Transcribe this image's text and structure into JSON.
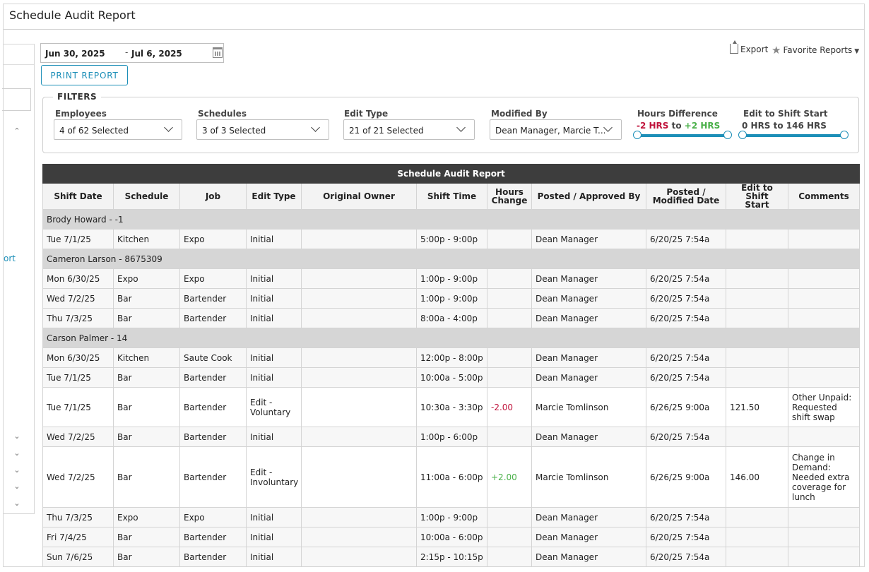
{
  "window": {
    "title": "Schedule Audit Report"
  },
  "left_panel": {
    "link_fragment": "ort"
  },
  "date_range": {
    "start": "Jun 30, 2025",
    "separator": "-",
    "end": "Jul 6, 2025"
  },
  "toolbar": {
    "print_label": "PRINT REPORT",
    "export_label": "Export",
    "favorites_label": "Favorite Reports"
  },
  "filters": {
    "legend": "FILTERS",
    "employees": {
      "label": "Employees",
      "value": "4 of 62 Selected"
    },
    "schedules": {
      "label": "Schedules",
      "value": "3 of 3 Selected"
    },
    "edit_type": {
      "label": "Edit Type",
      "value": "21 of 21 Selected"
    },
    "modified_by": {
      "label": "Modified By",
      "value": "Dean Manager, Marcie T..."
    },
    "hours_difference": {
      "label": "Hours Difference",
      "min": "-2 HRS",
      "to": "to",
      "max": "+2 HRS"
    },
    "edit_to_shift_start": {
      "label": "Edit to Shift Start",
      "range": "0 HRS to 146 HRS"
    }
  },
  "report": {
    "title": "Schedule Audit Report",
    "columns": {
      "shift_date": "Shift Date",
      "schedule": "Schedule",
      "job": "Job",
      "edit_type": "Edit Type",
      "original_owner": "Original Owner",
      "shift_time": "Shift Time",
      "hours_change_1": "Hours",
      "hours_change_2": "Change",
      "posted_by": "Posted / Approved By",
      "posted_date_1": "Posted /",
      "posted_date_2": "Modified Date",
      "edit_start_1": "Edit to Shift",
      "edit_start_2": "Start",
      "comments": "Comments"
    },
    "groups": [
      {
        "name": "Brody Howard - -1"
      },
      {
        "name": "Cameron Larson - 8675309"
      },
      {
        "name": "Carson Palmer - 14"
      }
    ],
    "rows": [
      {
        "date": "Tue 7/1/25",
        "schedule": "Kitchen",
        "job": "Expo",
        "edit_type": "Initial",
        "original_owner": "",
        "shift_time": "5:00p - 9:00p",
        "hours_change": "",
        "posted_by": "Dean Manager",
        "posted_date": "6/20/25 7:54a",
        "edit_to_start": "",
        "comments": ""
      },
      {
        "date": "Mon 6/30/25",
        "schedule": "Expo",
        "job": "Expo",
        "edit_type": "Initial",
        "original_owner": "",
        "shift_time": "1:00p - 9:00p",
        "hours_change": "",
        "posted_by": "Dean Manager",
        "posted_date": "6/20/25 7:54a",
        "edit_to_start": "",
        "comments": ""
      },
      {
        "date": "Wed 7/2/25",
        "schedule": "Bar",
        "job": "Bartender",
        "edit_type": "Initial",
        "original_owner": "",
        "shift_time": "1:00p - 9:00p",
        "hours_change": "",
        "posted_by": "Dean Manager",
        "posted_date": "6/20/25 7:54a",
        "edit_to_start": "",
        "comments": ""
      },
      {
        "date": "Thu 7/3/25",
        "schedule": "Bar",
        "job": "Bartender",
        "edit_type": "Initial",
        "original_owner": "",
        "shift_time": "8:00a - 4:00p",
        "hours_change": "",
        "posted_by": "Dean Manager",
        "posted_date": "6/20/25 7:54a",
        "edit_to_start": "",
        "comments": ""
      },
      {
        "date": "Mon 6/30/25",
        "schedule": "Kitchen",
        "job": "Saute Cook",
        "edit_type": "Initial",
        "original_owner": "",
        "shift_time": "12:00p - 8:00p",
        "hours_change": "",
        "posted_by": "Dean Manager",
        "posted_date": "6/20/25 7:54a",
        "edit_to_start": "",
        "comments": ""
      },
      {
        "date": "Tue 7/1/25",
        "schedule": "Bar",
        "job": "Bartender",
        "edit_type": "Initial",
        "original_owner": "",
        "shift_time": "10:00a - 5:00p",
        "hours_change": "",
        "posted_by": "Dean Manager",
        "posted_date": "6/20/25 7:54a",
        "edit_to_start": "",
        "comments": ""
      },
      {
        "date": "Tue 7/1/25",
        "schedule": "Bar",
        "job": "Bartender",
        "edit_type": "Edit - Voluntary",
        "original_owner": "",
        "shift_time": "10:30a - 3:30p",
        "hours_change": "-2.00",
        "posted_by": "Marcie Tomlinson",
        "posted_date": "6/26/25 9:00a",
        "edit_to_start": "121.50",
        "comments": "Other Unpaid: Requested shift swap"
      },
      {
        "date": "Wed 7/2/25",
        "schedule": "Bar",
        "job": "Bartender",
        "edit_type": "Initial",
        "original_owner": "",
        "shift_time": "1:00p - 6:00p",
        "hours_change": "",
        "posted_by": "Dean Manager",
        "posted_date": "6/20/25 7:54a",
        "edit_to_start": "",
        "comments": ""
      },
      {
        "date": "Wed 7/2/25",
        "schedule": "Bar",
        "job": "Bartender",
        "edit_type": "Edit - Involuntary",
        "original_owner": "",
        "shift_time": "11:00a - 6:00p",
        "hours_change": "+2.00",
        "posted_by": "Marcie Tomlinson",
        "posted_date": "6/26/25 9:00a",
        "edit_to_start": "146.00",
        "comments": "Change in Demand: Needed extra coverage for lunch"
      },
      {
        "date": "Thu 7/3/25",
        "schedule": "Expo",
        "job": "Expo",
        "edit_type": "Initial",
        "original_owner": "",
        "shift_time": "1:00p - 9:00p",
        "hours_change": "",
        "posted_by": "Dean Manager",
        "posted_date": "6/20/25 7:54a",
        "edit_to_start": "",
        "comments": ""
      },
      {
        "date": "Fri 7/4/25",
        "schedule": "Bar",
        "job": "Bartender",
        "edit_type": "Initial",
        "original_owner": "",
        "shift_time": "10:00a - 6:00p",
        "hours_change": "",
        "posted_by": "Dean Manager",
        "posted_date": "6/20/25 7:54a",
        "edit_to_start": "",
        "comments": ""
      },
      {
        "date": "Sun 7/6/25",
        "schedule": "Bar",
        "job": "Bartender",
        "edit_type": "Initial",
        "original_owner": "",
        "shift_time": "2:15p - 10:15p",
        "hours_change": "",
        "posted_by": "Dean Manager",
        "posted_date": "6/20/25 7:54a",
        "edit_to_start": "",
        "comments": ""
      }
    ]
  },
  "colors": {
    "accent": "#1d8fb8",
    "negative": "#c0143c",
    "positive": "#4ab049",
    "header_bg": "#3d3d3d",
    "group_bg": "#d6d6d6"
  }
}
